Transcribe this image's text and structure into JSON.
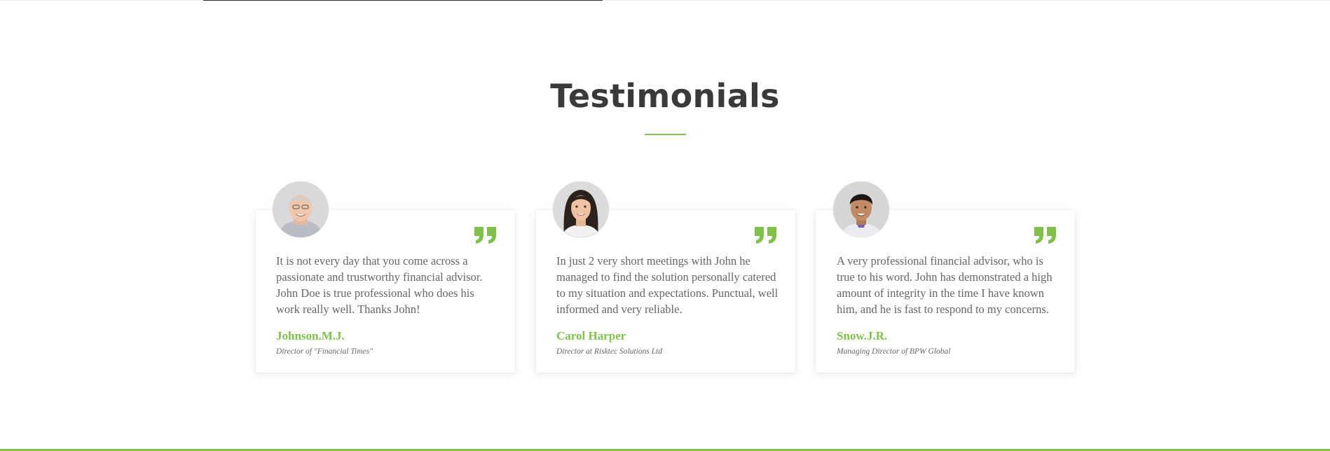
{
  "section": {
    "title": "Testimonials",
    "accent_color": "#7fc14a"
  },
  "testimonials": [
    {
      "quote": "It is not every day that you come across a passionate and trustworthy financial advisor. John Doe is true professional who does his work really well. Thanks John!",
      "author": "Johnson.M.J.",
      "role": "Director of \"Financial Times\"",
      "avatar_icon": "avatar-older-man-photo",
      "quote_icon": "quote-icon"
    },
    {
      "quote": "In just 2 very short meetings with John he managed to find the solution personally catered to my situation and expectations. Punctual, well informed and very reliable.",
      "author": "Carol Harper",
      "role": "Director at Risktec Solutions Ltd",
      "avatar_icon": "avatar-woman-photo",
      "quote_icon": "quote-icon"
    },
    {
      "quote": "A very professional financial advisor, who is true to his word. John has demonstrated a high amount of integrity in the time I have known him, and he is fast to respond to my concerns.",
      "author": "Snow.J.R.",
      "role": "Managing Director of BPW Global",
      "avatar_icon": "avatar-young-man-photo",
      "quote_icon": "quote-icon"
    }
  ]
}
